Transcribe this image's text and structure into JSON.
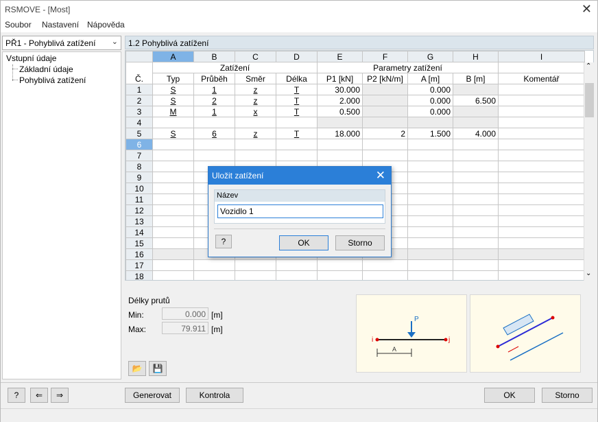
{
  "window": {
    "title": "RSMOVE - [Most]"
  },
  "menu": [
    "Soubor",
    "Nastavení",
    "Nápověda"
  ],
  "nav": {
    "selected": "PŘ1 - Pohyblivá zatížení",
    "tree_root": "Vstupní údaje",
    "tree_children": [
      "Základní údaje",
      "Pohyblivá zatížení"
    ]
  },
  "section_title": "1.2 Pohyblivá zatížení",
  "table": {
    "column_letters": [
      "A",
      "B",
      "C",
      "D",
      "E",
      "F",
      "G",
      "H",
      "I"
    ],
    "group_zatizeni": "Zatížení",
    "group_params": "Parametry zatížení",
    "row_header": "Č.",
    "headers": [
      "Typ",
      "Průběh",
      "Směr",
      "Délka",
      "P1 [kN]",
      "P2 [kN/m]",
      "A [m]",
      "B [m]",
      "Komentář"
    ],
    "rows": [
      {
        "n": "1",
        "typ": "S",
        "prubeh": "1",
        "smer": "z",
        "delka": "T",
        "p1": "30.000",
        "p2": "",
        "a": "0.000",
        "b": "",
        "kom": ""
      },
      {
        "n": "2",
        "typ": "S",
        "prubeh": "2",
        "smer": "z",
        "delka": "T",
        "p1": "2.000",
        "p2": "",
        "a": "0.000",
        "b": "6.500",
        "kom": ""
      },
      {
        "n": "3",
        "typ": "M",
        "prubeh": "1",
        "smer": "x",
        "delka": "T",
        "p1": "0.500",
        "p2": "",
        "a": "0.000",
        "b": "",
        "kom": ""
      },
      {
        "n": "4",
        "typ": "",
        "prubeh": "",
        "smer": "",
        "delka": "",
        "p1": "",
        "p2": "",
        "a": "",
        "b": "",
        "kom": ""
      },
      {
        "n": "5",
        "typ": "S",
        "prubeh": "6",
        "smer": "z",
        "delka": "T",
        "p1": "18.000",
        "p2": "2",
        "a": "1.500",
        "b": "4.000",
        "kom": ""
      },
      {
        "n": "6"
      },
      {
        "n": "7"
      },
      {
        "n": "8"
      },
      {
        "n": "9"
      },
      {
        "n": "10"
      },
      {
        "n": "11"
      },
      {
        "n": "12"
      },
      {
        "n": "13"
      },
      {
        "n": "14"
      },
      {
        "n": "15"
      },
      {
        "n": "16"
      },
      {
        "n": "17"
      },
      {
        "n": "18"
      }
    ]
  },
  "lengths": {
    "title": "Délky prutů",
    "min_label": "Min:",
    "min_value": "0.000",
    "max_label": "Max:",
    "max_value": "79.911",
    "unit": "[m]"
  },
  "diagram": {
    "load_label": "P",
    "node_i": "i",
    "node_j": "j",
    "dim_a": "A"
  },
  "buttons": {
    "generate": "Generovat",
    "check": "Kontrola",
    "ok": "OK",
    "cancel": "Storno"
  },
  "dialog": {
    "title": "Uložit zatížení",
    "group_label": "Název",
    "name_value": "Vozidlo 1",
    "ok": "OK",
    "cancel": "Storno"
  }
}
